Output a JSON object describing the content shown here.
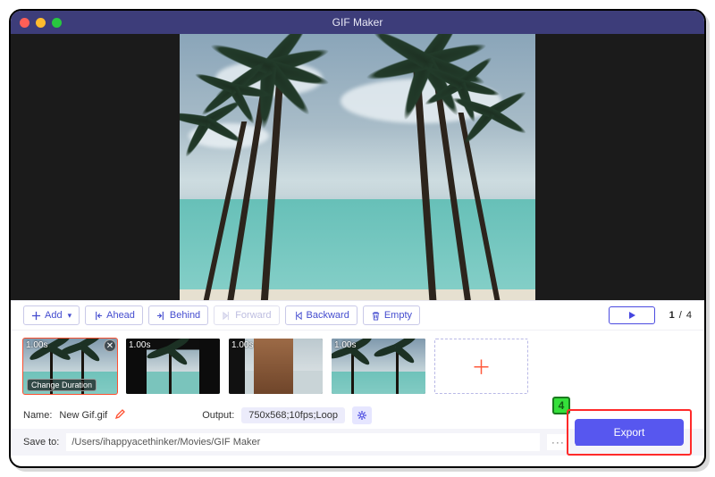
{
  "window": {
    "title": "GIF Maker"
  },
  "toolbar": {
    "add": "Add",
    "ahead": "Ahead",
    "behind": "Behind",
    "forward": "Forward",
    "backward": "Backward",
    "empty": "Empty"
  },
  "pager": {
    "current": "1",
    "sep": "/",
    "total": "4"
  },
  "thumbs": [
    {
      "duration": "1.00s",
      "change_label": "Change Duration",
      "selected": true
    },
    {
      "duration": "1.00s",
      "selected": false
    },
    {
      "duration": "1.00s",
      "selected": false
    },
    {
      "duration": "1.00s",
      "selected": false
    }
  ],
  "fields": {
    "name_label": "Name:",
    "name_value": "New Gif.gif",
    "output_label": "Output:",
    "output_value": "750x568;10fps;Loop",
    "save_label": "Save to:",
    "save_path": "/Users/ihappyacethinker/Movies/GIF Maker"
  },
  "export": {
    "label": "Export"
  },
  "annotation": {
    "badge": "4"
  }
}
